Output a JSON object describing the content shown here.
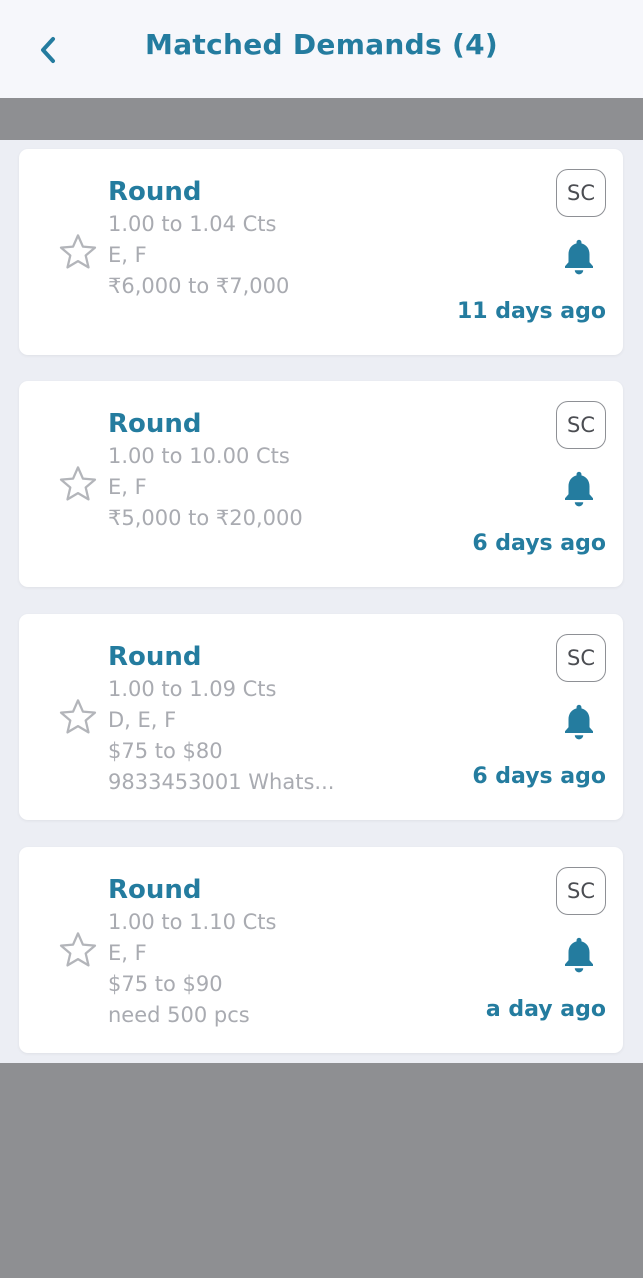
{
  "header": {
    "title": "Matched Demands (4)",
    "back_icon": "chevron-left-icon"
  },
  "colors": {
    "accent": "#247c9f",
    "muted_text": "#a9abb1",
    "background": "#eceef4",
    "overlay_gray": "#8e8f92"
  },
  "cards": [
    {
      "shape": "Round",
      "lines": [
        "1.00 to 1.04 Cts",
        "E, F",
        "₹6,000 to ₹7,000"
      ],
      "badge": "SC",
      "time": "11 days ago"
    },
    {
      "shape": "Round",
      "lines": [
        "1.00 to 10.00 Cts",
        "E, F",
        "₹5,000 to ₹20,000"
      ],
      "badge": "SC",
      "time": "6 days ago"
    },
    {
      "shape": "Round",
      "lines": [
        "1.00 to 1.09 Cts",
        "D, E, F",
        "$75 to $80",
        "9833453001 Whats..."
      ],
      "badge": "SC",
      "time": "6 days ago"
    },
    {
      "shape": "Round",
      "lines": [
        "1.00 to 1.10 Cts",
        "E, F",
        "$75 to $90",
        "need 500 pcs"
      ],
      "badge": "SC",
      "time": "a day ago"
    }
  ]
}
